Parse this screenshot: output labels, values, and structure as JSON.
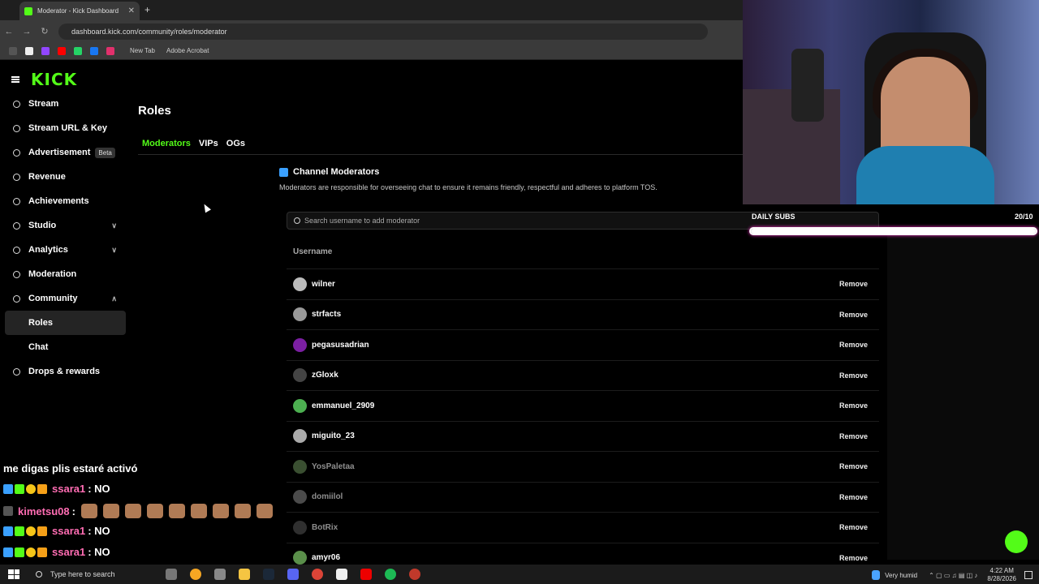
{
  "browser": {
    "tab_title": "Moderator - Kick Dashboard",
    "url": "dashboard.kick.com/community/roles/moderator",
    "bookmarks": [
      "New Tab",
      "Adobe Acrobat"
    ]
  },
  "sidebar": {
    "logo": "KICK",
    "items": [
      {
        "label": "Stream",
        "icon": "broadcast-icon"
      },
      {
        "label": "Stream URL & Key",
        "icon": "link-icon"
      },
      {
        "label": "Advertisement",
        "icon": "ad-icon",
        "badge": "Beta"
      },
      {
        "label": "Revenue",
        "icon": "revenue-icon"
      },
      {
        "label": "Achievements",
        "icon": "trophy-icon"
      },
      {
        "label": "Studio",
        "icon": "studio-icon"
      },
      {
        "label": "Analytics",
        "icon": "analytics-icon"
      },
      {
        "label": "Moderation",
        "icon": "hammer-icon"
      },
      {
        "label": "Community",
        "icon": "community-icon"
      },
      {
        "label": "Roles"
      },
      {
        "label": "Chat"
      },
      {
        "label": "Drops & rewards",
        "icon": "gift-icon"
      }
    ]
  },
  "main": {
    "title": "Roles",
    "tabs": [
      "Moderators",
      "VIPs",
      "OGs"
    ],
    "section_title": "Channel Moderators",
    "section_desc": "Moderators are responsible for overseeing chat to ensure it remains friendly, respectful and adheres to platform TOS.",
    "search_placeholder": "Search username to add moderator",
    "column_header": "Username",
    "remove_label": "Remove",
    "moderators": [
      "wilner",
      "strfacts",
      "pegasusadrian",
      "zGloxk",
      "emmanuel_2909",
      "miguito_23",
      "YosPaletaa",
      "domiilol",
      "BotRix",
      "amyr06"
    ]
  },
  "overlay": {
    "subs_label": "DAILY SUBS",
    "subs_count": "20/10",
    "subs_progress": 1.0,
    "chat": [
      {
        "text": "me digas plis estaré activó"
      },
      {
        "user": "ssara1",
        "msg": ": NO"
      },
      {
        "user": "kimetsu08",
        "msg": ":"
      },
      {
        "user": "ssara1",
        "msg": ": NO"
      },
      {
        "user": "ssara1",
        "msg": ": NO"
      }
    ]
  },
  "taskbar": {
    "search_placeholder": "Type here to search",
    "weather": "Very humid",
    "time": "4:22 AM",
    "date": "8/28/2026"
  },
  "colors": {
    "accent": "#53fc18",
    "chat_user": "#ff6db3"
  }
}
